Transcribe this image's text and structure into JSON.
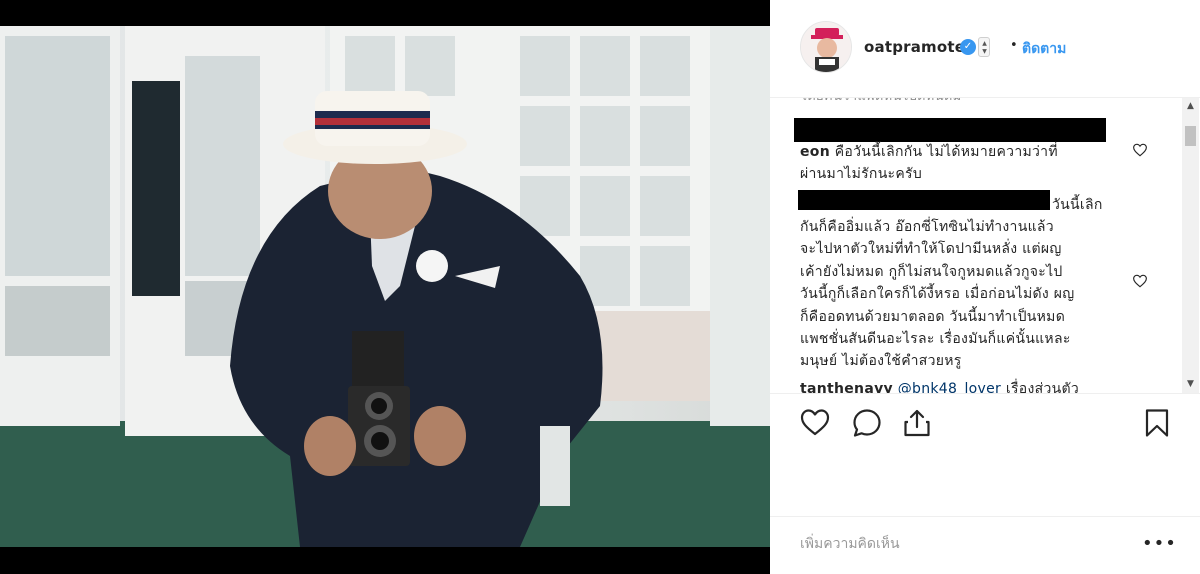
{
  "post": {
    "username": "oatpramote",
    "verified": true,
    "follow_label": "ติดตาม",
    "separator": "•",
    "verified_check": "✓"
  },
  "comments": {
    "clipped_top": "โดยคนว่าแพดหนไปดหนดิม",
    "c1": {
      "user": "eon",
      "text_line1": "คือวันนี้เลิกกัน ไม่ได้หมายความว่าที่",
      "text_line2": "ผ่านมาไม่รักนะครับ"
    },
    "c2": {
      "line1": "วันนี้เลิก",
      "line2": "กันก็คืออิ่มแล้ว อ๊อกซี่โทซินไม่ทำงานแล้ว",
      "line3": "จะไปหาตัวใหม่ที่ทำให้โดปามีนหลั่ง แต่ผญ",
      "line4": "เค้ายังไม่หมด กูก็ไม่สนใจกูหมดแล้วกูจะไป",
      "line5": "วันนี้กูก็เลือกใครก็ได้งี้หรอ เมื่อก่อนไม่ดัง ผญ",
      "line6": "ก็คืออดทนด้วยมาตลอด วันนี้มาทำเป็นหมด",
      "line7": "แพชชั่นสันดีนอะไรละ เรื่องมันก็แค่นั้นแหละ",
      "line8": "มนุษย์ ไม่ต้องใช้คำสวยหรู"
    },
    "c3": {
      "user": "tanthenavy",
      "mention": "@bnk48_lover",
      "text": "เรื่องส่วนตัว"
    }
  },
  "add_comment": {
    "placeholder": "เพิ่มความคิดเห็น",
    "more_label": "•••"
  },
  "scrollbar": {
    "up_arrow": "▲",
    "down_arrow": "▼"
  },
  "icons": {
    "like": "heart-icon",
    "comment": "comment-icon",
    "share": "share-icon",
    "save": "bookmark-icon"
  }
}
